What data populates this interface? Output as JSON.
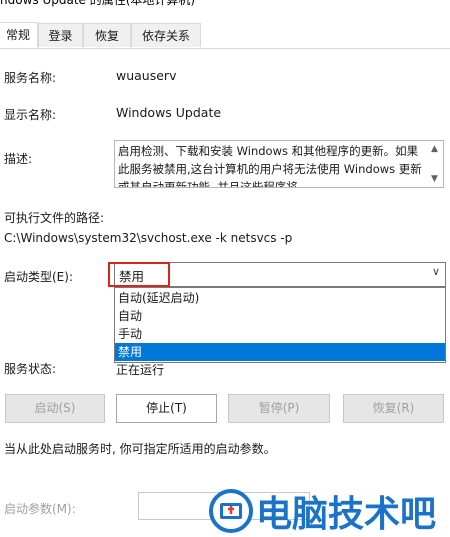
{
  "window": {
    "title_fragment": "ndows Update 的属性(本地计算机)"
  },
  "tabs": [
    {
      "label": "常规",
      "active": true
    },
    {
      "label": "登录",
      "active": false
    },
    {
      "label": "恢复",
      "active": false
    },
    {
      "label": "依存关系",
      "active": false
    }
  ],
  "fields": {
    "service_name_label": "服务名称:",
    "service_name_value": "wuauserv",
    "display_name_label": "显示名称:",
    "display_name_value": "Windows Update",
    "description_label": "描述:",
    "description_value": "启用检测、下载和安装 Windows 和其他程序的更新。如果此服务被禁用,这台计算机的用户将无法使用 Windows 更新或其自动更新功能, 并且这些程序将",
    "exe_path_label": "可执行文件的路径:",
    "exe_path_value": "C:\\Windows\\system32\\svchost.exe -k netsvcs -p"
  },
  "startup": {
    "label": "启动类型(E):",
    "selected": "禁用",
    "options": [
      "自动(延迟启动)",
      "自动",
      "手动",
      "禁用"
    ],
    "highlighted_index": 3
  },
  "status": {
    "label": "服务状态:",
    "value": "正在运行"
  },
  "buttons": {
    "start": "启动(S)",
    "stop": "停止(T)",
    "pause": "暂停(P)",
    "resume": "恢复(R)"
  },
  "hint": "当从此处启动服务时, 你可指定所适用的启动参数。",
  "params": {
    "label": "启动参数(M):",
    "value": ""
  },
  "watermark": {
    "text": "电脑技术吧"
  },
  "colors": {
    "highlight": "#0078d7",
    "red_box": "#d9261c",
    "watermark_blue": "#1b72c9"
  }
}
